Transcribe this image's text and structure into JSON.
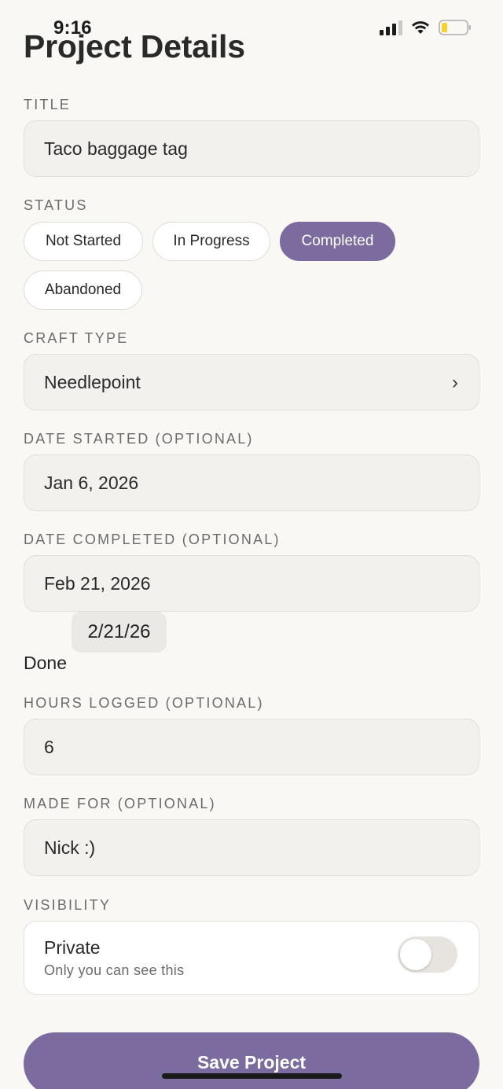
{
  "status_bar": {
    "time": "9:16"
  },
  "page": {
    "title": "Project Details"
  },
  "title_section": {
    "label": "TITLE",
    "value": "Taco baggage tag"
  },
  "status_section": {
    "label": "STATUS",
    "options": [
      "Not Started",
      "In Progress",
      "Completed",
      "Abandoned"
    ],
    "selected": "Completed"
  },
  "craft_section": {
    "label": "CRAFT TYPE",
    "value": "Needlepoint",
    "chevron": "›"
  },
  "date_started": {
    "label": "DATE STARTED (OPTIONAL)",
    "value": "Jan 6, 2026"
  },
  "date_completed": {
    "label": "DATE COMPLETED (OPTIONAL)",
    "value": "Feb 21, 2026",
    "picker_value": "2/21/26",
    "done_label": "Done"
  },
  "hours": {
    "label": "HOURS LOGGED (OPTIONAL)",
    "value": "6"
  },
  "made_for": {
    "label": "MADE FOR (OPTIONAL)",
    "value": "Nick :)"
  },
  "visibility": {
    "label": "VISIBILITY",
    "title": "Private",
    "subtitle": "Only you can see this",
    "toggle_on": false
  },
  "save_button": {
    "label": "Save Project"
  },
  "colors": {
    "accent": "#7c6b9f",
    "background": "#f9f8f5",
    "battery": "#f2d22e"
  },
  "icons": [
    "signal-icon",
    "wifi-icon",
    "battery-icon",
    "chevron-right-icon"
  ]
}
